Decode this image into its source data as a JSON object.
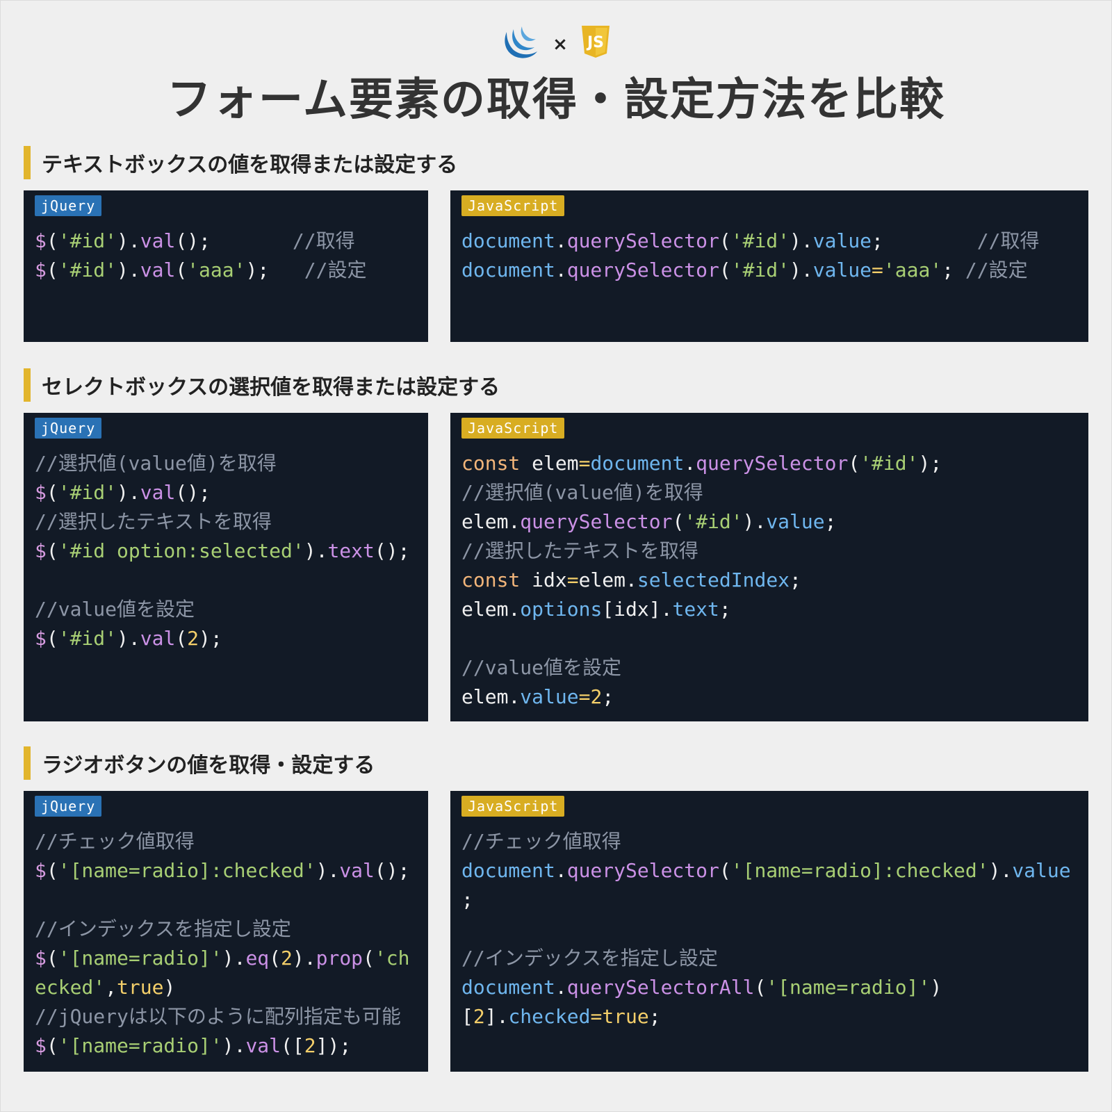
{
  "header": {
    "times_symbol": "×",
    "title": "フォーム要素の取得・設定方法を比較",
    "jquery_logo": "jquery-logo",
    "js_logo": "javascript-shield-logo",
    "js_logo_text": "JS"
  },
  "colors": {
    "background": "#efefef",
    "panel": "#121a26",
    "accent_bar": "#e2b52c",
    "badge_jquery": "#2a72b5",
    "badge_javascript": "#d8ad22",
    "string": "#a8cf74",
    "method": "#cb91e6",
    "property": "#6fb6ee",
    "comment": "#8d96a6",
    "number": "#f4cf6a",
    "keyword": "#f2b57a"
  },
  "sections": [
    {
      "heading": "テキストボックスの値を取得または設定する",
      "jquery": {
        "badge": "jQuery",
        "lines": [
          [
            [
              "$",
              "dollar"
            ],
            [
              "(",
              "pl"
            ],
            [
              "'#id'",
              "str"
            ],
            [
              ").",
              "pl"
            ],
            [
              "val",
              "meth"
            ],
            [
              "();",
              "pl"
            ],
            [
              "       //取得",
              "cmt"
            ]
          ],
          [
            [
              "$",
              "dollar"
            ],
            [
              "(",
              "pl"
            ],
            [
              "'#id'",
              "str"
            ],
            [
              ").",
              "pl"
            ],
            [
              "val",
              "meth"
            ],
            [
              "(",
              "pl"
            ],
            [
              "'aaa'",
              "str"
            ],
            [
              ");",
              "pl"
            ],
            [
              "   //設定",
              "cmt"
            ]
          ]
        ]
      },
      "javascript": {
        "badge": "JavaScript",
        "lines": [
          [
            [
              "document",
              "prop"
            ],
            [
              ".",
              "pl"
            ],
            [
              "querySelector",
              "meth"
            ],
            [
              "(",
              "pl"
            ],
            [
              "'#id'",
              "str"
            ],
            [
              ").",
              "pl"
            ],
            [
              "value",
              "prop"
            ],
            [
              ";",
              "pl"
            ],
            [
              "        //取得",
              "cmt"
            ]
          ],
          [
            [
              "document",
              "prop"
            ],
            [
              ".",
              "pl"
            ],
            [
              "querySelector",
              "meth"
            ],
            [
              "(",
              "pl"
            ],
            [
              "'#id'",
              "str"
            ],
            [
              ").",
              "pl"
            ],
            [
              "value",
              "prop"
            ],
            [
              "=",
              "op"
            ],
            [
              "'aaa'",
              "str"
            ],
            [
              "; ",
              "pl"
            ],
            [
              "//設定",
              "cmt"
            ]
          ]
        ]
      }
    },
    {
      "heading": "セレクトボックスの選択値を取得または設定する",
      "jquery": {
        "badge": "jQuery",
        "lines": [
          [
            [
              "//選択値(value値)を取得",
              "cmt"
            ]
          ],
          [
            [
              "$",
              "dollar"
            ],
            [
              "(",
              "pl"
            ],
            [
              "'#id'",
              "str"
            ],
            [
              ").",
              "pl"
            ],
            [
              "val",
              "meth"
            ],
            [
              "();",
              "pl"
            ]
          ],
          [
            [
              "//選択したテキストを取得",
              "cmt"
            ]
          ],
          [
            [
              "$",
              "dollar"
            ],
            [
              "(",
              "pl"
            ],
            [
              "'#id option:selected'",
              "str"
            ],
            [
              ").",
              "pl"
            ],
            [
              "text",
              "meth"
            ],
            [
              "();",
              "pl"
            ]
          ],
          [],
          [
            [
              "//value値を設定",
              "cmt"
            ]
          ],
          [
            [
              "$",
              "dollar"
            ],
            [
              "(",
              "pl"
            ],
            [
              "'#id'",
              "str"
            ],
            [
              ").",
              "pl"
            ],
            [
              "val",
              "meth"
            ],
            [
              "(",
              "pl"
            ],
            [
              "2",
              "num"
            ],
            [
              ");",
              "pl"
            ]
          ]
        ]
      },
      "javascript": {
        "badge": "JavaScript",
        "lines": [
          [
            [
              "const",
              "kw"
            ],
            [
              " elem",
              "pl"
            ],
            [
              "=",
              "op"
            ],
            [
              "document",
              "prop"
            ],
            [
              ".",
              "pl"
            ],
            [
              "querySelector",
              "meth"
            ],
            [
              "(",
              "pl"
            ],
            [
              "'#id'",
              "str"
            ],
            [
              ");",
              "pl"
            ]
          ],
          [
            [
              "//選択値(value値)を取得",
              "cmt"
            ]
          ],
          [
            [
              "elem",
              "pl"
            ],
            [
              ".",
              "pl"
            ],
            [
              "querySelector",
              "meth"
            ],
            [
              "(",
              "pl"
            ],
            [
              "'#id'",
              "str"
            ],
            [
              ").",
              "pl"
            ],
            [
              "value",
              "prop"
            ],
            [
              ";",
              "pl"
            ]
          ],
          [
            [
              "//選択したテキストを取得",
              "cmt"
            ]
          ],
          [
            [
              "const",
              "kw"
            ],
            [
              " idx",
              "pl"
            ],
            [
              "=",
              "op"
            ],
            [
              "elem",
              "pl"
            ],
            [
              ".",
              "pl"
            ],
            [
              "selectedIndex",
              "prop"
            ],
            [
              ";",
              "pl"
            ]
          ],
          [
            [
              "elem",
              "pl"
            ],
            [
              ".",
              "pl"
            ],
            [
              "options",
              "prop"
            ],
            [
              "[idx].",
              "pl"
            ],
            [
              "text",
              "prop"
            ],
            [
              ";",
              "pl"
            ]
          ],
          [],
          [
            [
              "//value値を設定",
              "cmt"
            ]
          ],
          [
            [
              "elem",
              "pl"
            ],
            [
              ".",
              "pl"
            ],
            [
              "value",
              "prop"
            ],
            [
              "=",
              "op"
            ],
            [
              "2",
              "num"
            ],
            [
              ";",
              "pl"
            ]
          ]
        ]
      }
    },
    {
      "heading": "ラジオボタンの値を取得・設定する",
      "jquery": {
        "badge": "jQuery",
        "lines": [
          [
            [
              "//チェック値取得",
              "cmt"
            ]
          ],
          [
            [
              "$",
              "dollar"
            ],
            [
              "(",
              "pl"
            ],
            [
              "'[name=radio]:checked'",
              "str"
            ],
            [
              ").",
              "pl"
            ],
            [
              "val",
              "meth"
            ],
            [
              "();",
              "pl"
            ]
          ],
          [],
          [
            [
              "//インデックスを指定し設定",
              "cmt"
            ]
          ],
          [
            [
              "$",
              "dollar"
            ],
            [
              "(",
              "pl"
            ],
            [
              "'[name=radio]'",
              "str"
            ],
            [
              ").",
              "pl"
            ],
            [
              "eq",
              "meth"
            ],
            [
              "(",
              "pl"
            ],
            [
              "2",
              "num"
            ],
            [
              ").",
              "pl"
            ],
            [
              "prop",
              "meth"
            ],
            [
              "(",
              "pl"
            ],
            [
              "'ch",
              "str"
            ]
          ],
          [
            [
              "ecked'",
              "str"
            ],
            [
              ",",
              "pl"
            ],
            [
              "true",
              "num"
            ],
            [
              ")",
              "pl"
            ]
          ],
          [
            [
              "//jQueryは以下のように配列指定も可能",
              "cmt"
            ]
          ],
          [
            [
              "$",
              "dollar"
            ],
            [
              "(",
              "pl"
            ],
            [
              "'[name=radio]'",
              "str"
            ],
            [
              ").",
              "pl"
            ],
            [
              "val",
              "meth"
            ],
            [
              "([",
              "pl"
            ],
            [
              "2",
              "num"
            ],
            [
              "]);",
              "pl"
            ]
          ]
        ]
      },
      "javascript": {
        "badge": "JavaScript",
        "lines": [
          [
            [
              "//チェック値取得",
              "cmt"
            ]
          ],
          [
            [
              "document",
              "prop"
            ],
            [
              ".",
              "pl"
            ],
            [
              "querySelector",
              "meth"
            ],
            [
              "(",
              "pl"
            ],
            [
              "'[name=radio]:checked'",
              "str"
            ],
            [
              ").",
              "pl"
            ],
            [
              "value",
              "prop"
            ]
          ],
          [
            [
              ";",
              "pl"
            ]
          ],
          [],
          [
            [
              "//インデックスを指定し設定",
              "cmt"
            ]
          ],
          [
            [
              "document",
              "prop"
            ],
            [
              ".",
              "pl"
            ],
            [
              "querySelectorAll",
              "meth"
            ],
            [
              "(",
              "pl"
            ],
            [
              "'[name=radio]'",
              "str"
            ],
            [
              ")",
              "pl"
            ]
          ],
          [
            [
              "[",
              "pl"
            ],
            [
              "2",
              "num"
            ],
            [
              "].",
              "pl"
            ],
            [
              "checked",
              "prop"
            ],
            [
              "=",
              "op"
            ],
            [
              "true",
              "num"
            ],
            [
              ";",
              "pl"
            ]
          ]
        ]
      }
    }
  ]
}
